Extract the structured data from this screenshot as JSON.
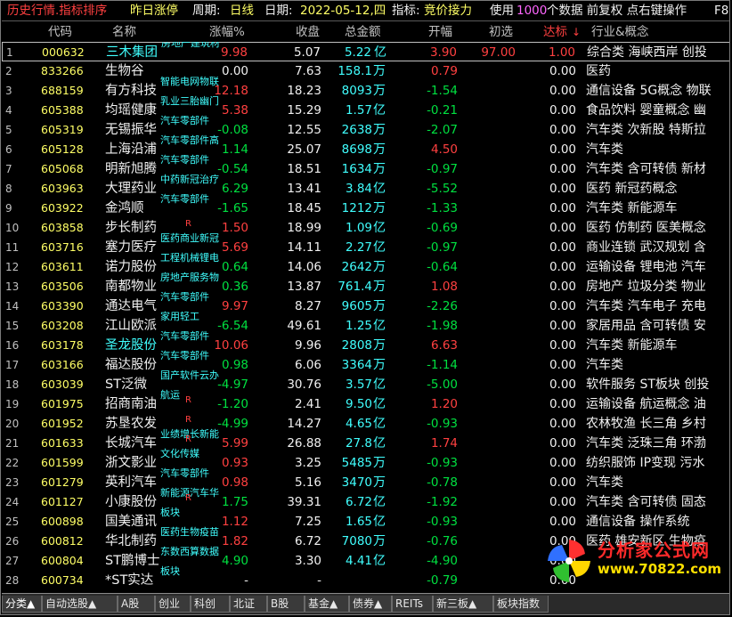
{
  "titlebar": {
    "seg1": "历史行情.指标排序",
    "seg2": "昨日涨停",
    "seg3": "周期:",
    "seg4": "日线",
    "seg5": "日期:",
    "seg6": "2022-05-12,四",
    "seg7": "指标:",
    "seg8": "竞价接力",
    "seg9": "使用",
    "seg10": "1000",
    "seg11": "个数据 前复权 点右键操作",
    "seg12": "F8"
  },
  "columns": {
    "code": "代码",
    "name": "名称",
    "chg": "涨幅%",
    "close": "收盘",
    "amt": "总金额",
    "open": "开幅",
    "init": "初选",
    "reach": "达标",
    "ind": "行业&概念"
  },
  "rows": [
    {
      "no": "1",
      "code": "000632",
      "name": "三木集团",
      "tag": "房地产建筑材",
      "r": "",
      "chg": "9.98",
      "chg_c": "red",
      "close": "5.07",
      "amt": "5.22",
      "unit": "亿",
      "open": "3.90",
      "open_c": "red",
      "init": "97.00",
      "reach": "1.00",
      "reach_c": "red",
      "ind": "综合类 海峡西岸 创投",
      "name_c": "cyan",
      "sel": true
    },
    {
      "no": "2",
      "code": "833266",
      "name": "生物谷",
      "tag": "",
      "r": "",
      "chg": "0.00",
      "chg_c": "white",
      "close": "7.63",
      "amt": "158.1",
      "unit": "万",
      "open": "0.79",
      "open_c": "red",
      "init": "",
      "reach": "0.00",
      "reach_c": "white",
      "ind": "医药"
    },
    {
      "no": "3",
      "code": "688159",
      "name": "有方科技",
      "tag": "智能电网物联",
      "r": "",
      "chg": "12.18",
      "chg_c": "red",
      "close": "18.23",
      "amt": "8093",
      "unit": "万",
      "open": "-1.54",
      "open_c": "green",
      "init": "",
      "reach": "0.00",
      "reach_c": "white",
      "ind": "通信设备 5G概念 物联"
    },
    {
      "no": "4",
      "code": "605388",
      "name": "均瑶健康",
      "tag": "乳业三胎幽门",
      "r": "",
      "chg": "5.38",
      "chg_c": "red",
      "close": "15.29",
      "amt": "1.57",
      "unit": "亿",
      "open": "-0.21",
      "open_c": "green",
      "init": "",
      "reach": "0.00",
      "reach_c": "white",
      "ind": "食品饮料 婴童概念 幽"
    },
    {
      "no": "5",
      "code": "605319",
      "name": "无锡振华",
      "tag": "汽车零部件",
      "r": "",
      "chg": "-0.08",
      "chg_c": "green",
      "close": "12.55",
      "amt": "2638",
      "unit": "万",
      "open": "-2.07",
      "open_c": "green",
      "init": "",
      "reach": "0.00",
      "reach_c": "white",
      "ind": "汽车类 次新股 特斯拉"
    },
    {
      "no": "6",
      "code": "605128",
      "name": "上海沿浦",
      "tag": "汽车零部件高",
      "r": "",
      "chg": "1.14",
      "chg_c": "green",
      "close": "25.07",
      "amt": "8698",
      "unit": "万",
      "open": "4.50",
      "open_c": "red",
      "init": "",
      "reach": "0.00",
      "reach_c": "white",
      "ind": "汽车类"
    },
    {
      "no": "7",
      "code": "605068",
      "name": "明新旭腾",
      "tag": "汽车零部件",
      "r": "",
      "chg": "-0.54",
      "chg_c": "green",
      "close": "18.51",
      "amt": "1634",
      "unit": "万",
      "open": "-0.97",
      "open_c": "green",
      "init": "",
      "reach": "0.00",
      "reach_c": "white",
      "ind": "汽车类 含可转债 新材"
    },
    {
      "no": "8",
      "code": "603963",
      "name": "大理药业",
      "tag": "中药新冠治疗",
      "r": "",
      "chg": "6.29",
      "chg_c": "green",
      "close": "13.41",
      "amt": "3.84",
      "unit": "亿",
      "open": "-5.52",
      "open_c": "green",
      "init": "",
      "reach": "0.00",
      "reach_c": "white",
      "ind": "医药 新冠药概念"
    },
    {
      "no": "9",
      "code": "603922",
      "name": "金鸿顺",
      "tag": "汽车零部件",
      "r": "",
      "chg": "-1.65",
      "chg_c": "green",
      "close": "18.45",
      "amt": "1212",
      "unit": "万",
      "open": "-1.33",
      "open_c": "green",
      "init": "",
      "reach": "0.00",
      "reach_c": "white",
      "ind": "汽车类 新能源车"
    },
    {
      "no": "10",
      "code": "603858",
      "name": "步长制药",
      "tag": "",
      "r": "R",
      "chg": "1.50",
      "chg_c": "red",
      "close": "18.99",
      "amt": "1.09",
      "unit": "亿",
      "open": "-0.69",
      "open_c": "green",
      "init": "",
      "reach": "0.00",
      "reach_c": "white",
      "ind": "医药 仿制药 医美概念"
    },
    {
      "no": "11",
      "code": "603716",
      "name": "塞力医疗",
      "tag": "医药商业新冠",
      "r": "",
      "chg": "5.69",
      "chg_c": "red",
      "close": "14.11",
      "amt": "2.27",
      "unit": "亿",
      "open": "-0.97",
      "open_c": "green",
      "init": "",
      "reach": "0.00",
      "reach_c": "white",
      "ind": "商业连锁 武汉规划 含"
    },
    {
      "no": "12",
      "code": "603611",
      "name": "诺力股份",
      "tag": "工程机械锂电",
      "r": "",
      "chg": "0.64",
      "chg_c": "green",
      "close": "14.06",
      "amt": "2642",
      "unit": "万",
      "open": "-0.64",
      "open_c": "green",
      "init": "",
      "reach": "0.00",
      "reach_c": "white",
      "ind": "运输设备 锂电池 汽车"
    },
    {
      "no": "13",
      "code": "603506",
      "name": "南都物业",
      "tag": "房地产服务物",
      "r": "",
      "chg": "0.36",
      "chg_c": "green",
      "close": "13.87",
      "amt": "761.4",
      "unit": "万",
      "open": "1.08",
      "open_c": "red",
      "init": "",
      "reach": "0.00",
      "reach_c": "white",
      "ind": "房地产 垃圾分类 物业"
    },
    {
      "no": "14",
      "code": "603390",
      "name": "通达电气",
      "tag": "汽车零部件",
      "r": "",
      "chg": "9.97",
      "chg_c": "red",
      "close": "8.27",
      "amt": "9605",
      "unit": "万",
      "open": "-2.26",
      "open_c": "green",
      "init": "",
      "reach": "0.00",
      "reach_c": "white",
      "ind": "汽车类 汽车电子 充电"
    },
    {
      "no": "15",
      "code": "603208",
      "name": "江山欧派",
      "tag": "家用轻工",
      "r": "",
      "chg": "-6.54",
      "chg_c": "green",
      "close": "49.61",
      "amt": "1.25",
      "unit": "亿",
      "open": "-1.98",
      "open_c": "green",
      "init": "",
      "reach": "0.00",
      "reach_c": "white",
      "ind": "家居用品 含可转债 安"
    },
    {
      "no": "16",
      "code": "603178",
      "name": "圣龙股份",
      "tag": "汽车零部件",
      "r": "",
      "chg": "10.06",
      "chg_c": "red",
      "close": "9.96",
      "amt": "2808",
      "unit": "万",
      "open": "6.63",
      "open_c": "red",
      "init": "",
      "reach": "0.00",
      "reach_c": "white",
      "ind": "汽车类 新能源车",
      "name_c": "cyan"
    },
    {
      "no": "17",
      "code": "603166",
      "name": "福达股份",
      "tag": "汽车零部件",
      "r": "",
      "chg": "0.98",
      "chg_c": "green",
      "close": "6.06",
      "amt": "3364",
      "unit": "万",
      "open": "-1.14",
      "open_c": "green",
      "init": "",
      "reach": "0.00",
      "reach_c": "white",
      "ind": "汽车类"
    },
    {
      "no": "18",
      "code": "603039",
      "name": "ST泛微",
      "tag": "国产软件云办",
      "r": "",
      "chg": "-4.97",
      "chg_c": "green",
      "close": "30.76",
      "amt": "3.57",
      "unit": "亿",
      "open": "-5.00",
      "open_c": "green",
      "init": "",
      "reach": "0.00",
      "reach_c": "white",
      "ind": "软件服务 ST板块 创投"
    },
    {
      "no": "19",
      "code": "601975",
      "name": "招商南油",
      "tag": "航运",
      "r": "R",
      "chg": "-1.20",
      "chg_c": "green",
      "close": "2.41",
      "amt": "9.50",
      "unit": "亿",
      "open": "1.20",
      "open_c": "red",
      "init": "",
      "reach": "0.00",
      "reach_c": "white",
      "ind": "运输设备 航运概念 油"
    },
    {
      "no": "20",
      "code": "601952",
      "name": "苏垦农发",
      "tag": "",
      "r": "R",
      "chg": "-4.99",
      "chg_c": "green",
      "close": "14.27",
      "amt": "4.65",
      "unit": "亿",
      "open": "-0.93",
      "open_c": "green",
      "init": "",
      "reach": "0.00",
      "reach_c": "white",
      "ind": "农林牧渔 长三角 乡村"
    },
    {
      "no": "21",
      "code": "601633",
      "name": "长城汽车",
      "tag": "业绩增长新能",
      "r": "R",
      "chg": "5.99",
      "chg_c": "red",
      "close": "26.88",
      "amt": "27.8",
      "unit": "亿",
      "open": "1.74",
      "open_c": "red",
      "init": "",
      "reach": "0.00",
      "reach_c": "white",
      "ind": "汽车类 泛珠三角 环渤"
    },
    {
      "no": "22",
      "code": "601599",
      "name": "浙文影业",
      "tag": "文化传媒",
      "r": "",
      "chg": "0.93",
      "chg_c": "red",
      "close": "3.25",
      "amt": "5485",
      "unit": "万",
      "open": "-0.93",
      "open_c": "green",
      "init": "",
      "reach": "0.00",
      "reach_c": "white",
      "ind": "纺织服饰 IP变现 污水"
    },
    {
      "no": "23",
      "code": "601279",
      "name": "英利汽车",
      "tag": "汽车零部件",
      "r": "",
      "chg": "0.98",
      "chg_c": "red",
      "close": "5.16",
      "amt": "3470",
      "unit": "万",
      "open": "-0.78",
      "open_c": "green",
      "init": "",
      "reach": "0.00",
      "reach_c": "white",
      "ind": "汽车类"
    },
    {
      "no": "24",
      "code": "601127",
      "name": "小康股份",
      "tag": "新能源汽车华",
      "r": "R",
      "chg": "1.75",
      "chg_c": "green",
      "close": "39.31",
      "amt": "6.72",
      "unit": "亿",
      "open": "-1.92",
      "open_c": "green",
      "init": "",
      "reach": "0.00",
      "reach_c": "white",
      "ind": "汽车类 含可转债 固态"
    },
    {
      "no": "25",
      "code": "600898",
      "name": "国美通讯",
      "tag": "板块",
      "r": "",
      "chg": "1.12",
      "chg_c": "red",
      "close": "7.25",
      "amt": "1.65",
      "unit": "亿",
      "open": "-0.93",
      "open_c": "green",
      "init": "",
      "reach": "0.00",
      "reach_c": "white",
      "ind": "通信设备 操作系统"
    },
    {
      "no": "26",
      "code": "600812",
      "name": "华北制药",
      "tag": "医药生物疫苗",
      "r": "",
      "chg": "1.82",
      "chg_c": "red",
      "close": "6.72",
      "amt": "7080",
      "unit": "万",
      "open": "-0.76",
      "open_c": "green",
      "init": "",
      "reach": "0.00",
      "reach_c": "white",
      "ind": "医药 雄安新区 生物疫"
    },
    {
      "no": "27",
      "code": "600804",
      "name": "ST鹏博士",
      "tag": "东数西算数据",
      "r": "",
      "chg": "4.90",
      "chg_c": "green",
      "close": "3.30",
      "amt": "4.41",
      "unit": "亿",
      "open": "-4.90",
      "open_c": "green",
      "init": "",
      "reach": "0.00",
      "reach_c": "white",
      "ind": ""
    },
    {
      "no": "28",
      "code": "600734",
      "name": "*ST实达",
      "tag": "板块",
      "r": "",
      "chg": "-",
      "chg_c": "white",
      "close": "-",
      "amt": "",
      "unit": "",
      "open": "-0.79",
      "open_c": "green",
      "init": "",
      "reach": "0.00",
      "reach_c": "white",
      "ind": ""
    }
  ],
  "tabs": [
    "分类▲",
    "自动选股▲",
    "A股",
    "创业",
    "科创",
    "北证",
    "B股",
    "基金▲",
    "债券▲",
    "REITs",
    "新三板▲",
    "板块指数"
  ],
  "logo": {
    "brand": "分析家公式网",
    "url": "www.70822.com"
  }
}
